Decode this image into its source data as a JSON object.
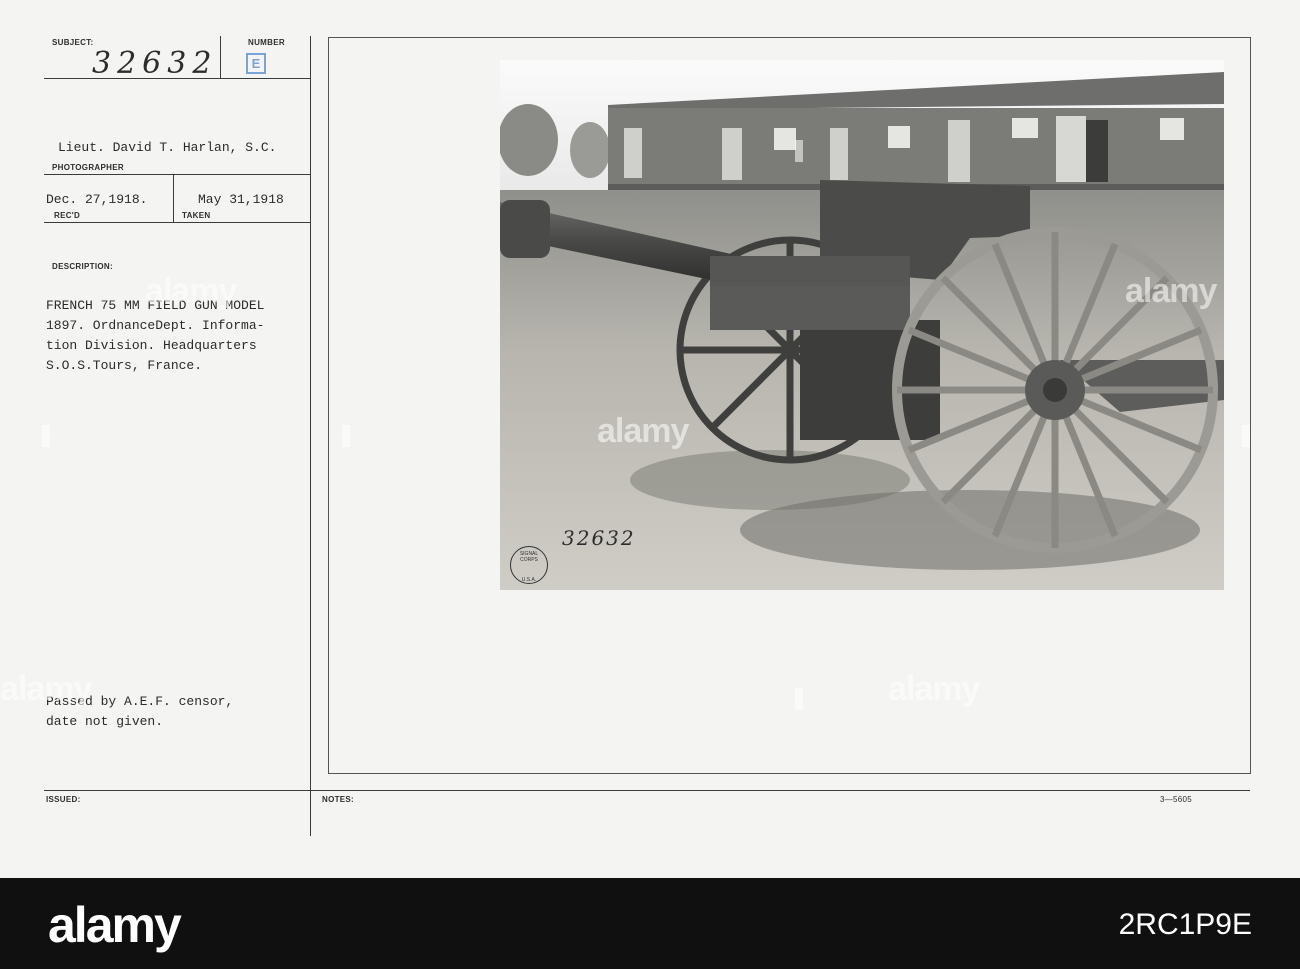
{
  "form": {
    "subject_label": "SUBJECT:",
    "subject_number": "32632",
    "number_label": "NUMBER",
    "number_letter": "E",
    "photographer": "Lieut. David T. Harlan, S.C.",
    "photographer_label": "PHOTOGRAPHER",
    "received_date": "Dec. 27,1918.",
    "received_label": "REC'D",
    "taken_date": "May 31,1918",
    "taken_label": "TAKEN",
    "description_label": "DESCRIPTION:",
    "description_lines": [
      "FRENCH 75 MM FIELD GUN MODEL",
      "1897. OrdnanceDept. Informa-",
      "tion Division. Headquarters",
      "S.O.S.Tours, France."
    ],
    "censor_lines": [
      "Passed by A.E.F. censor,",
      "date not given."
    ],
    "issued_label": "ISSUED:",
    "notes_label": "NOTES:",
    "form_code": "3—5605"
  },
  "photo": {
    "handwritten_number": "32632",
    "stamp_lines": [
      "SIGNAL CORPS",
      "U.S.A."
    ]
  },
  "watermark": {
    "text": "alamy"
  },
  "banner": {
    "logo": "alamy",
    "image_id": "2RC1P9E",
    "background": "#101010"
  }
}
